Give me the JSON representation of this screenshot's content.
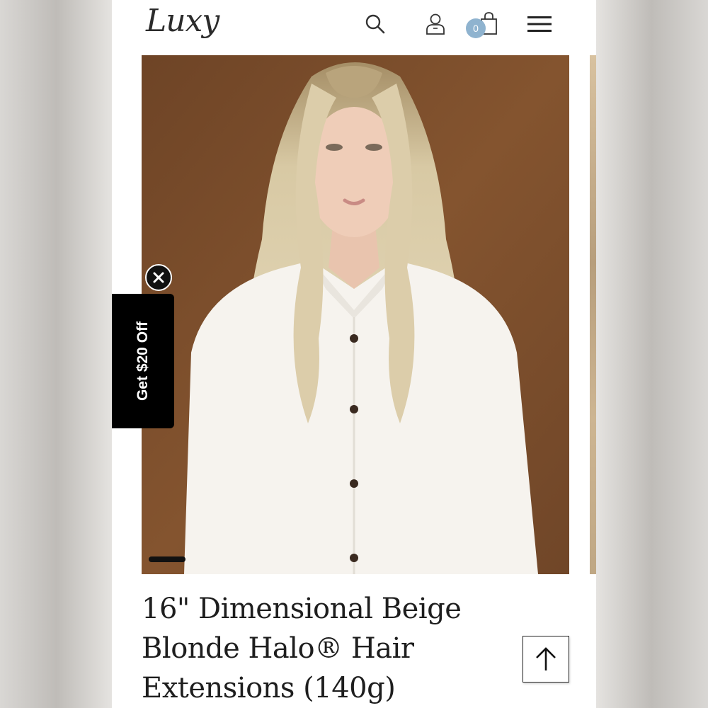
{
  "header": {
    "logo_text": "Luxy",
    "icons": [
      "search-icon",
      "account-icon",
      "shopping-bag-icon",
      "hamburger-menu-icon"
    ],
    "cart_count": "0",
    "cart_badge_color": "#8fb3cf"
  },
  "gallery": {
    "background_color": "#7a4d2c",
    "pager_active_index": 1
  },
  "promo": {
    "label": "Get $20 Off",
    "close_icon": "close-icon"
  },
  "product": {
    "title": "16\" Dimensional Beige Blonde Halo® Hair Extensions (140g)"
  },
  "scroll_top_icon": "arrow-up-icon"
}
